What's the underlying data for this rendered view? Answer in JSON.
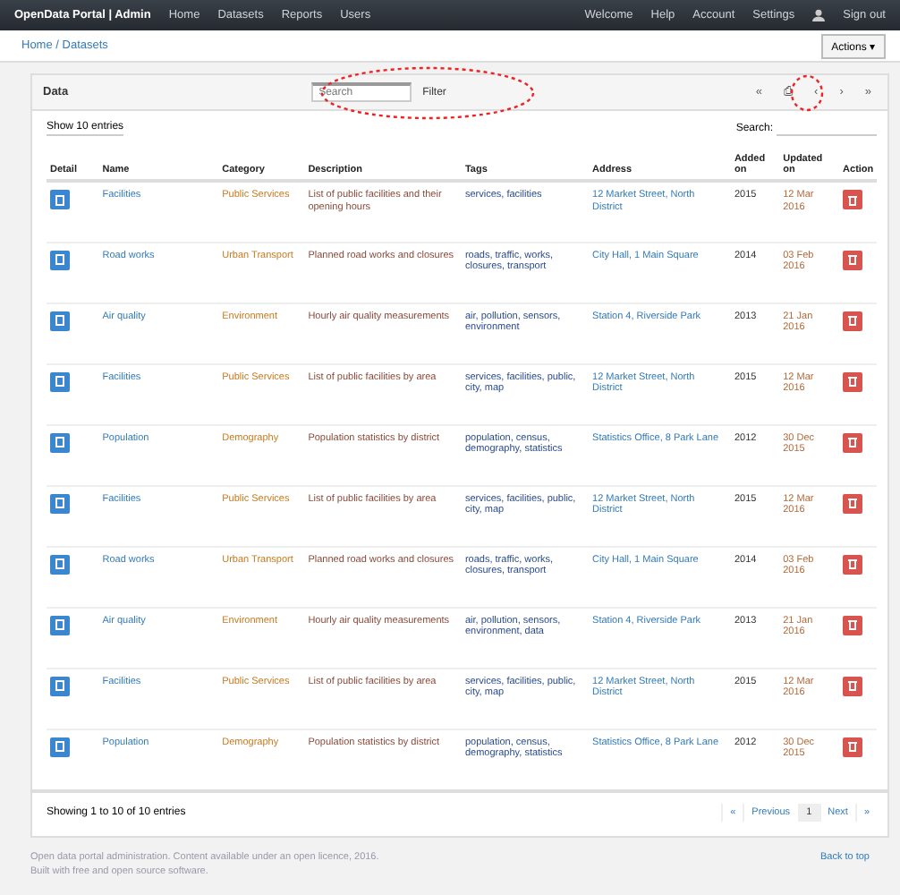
{
  "navbar": {
    "brand": "OpenData Portal | Admin",
    "links": [
      "Home",
      "Datasets",
      "Reports",
      "Users"
    ],
    "right_links": [
      "Welcome",
      "Help",
      "Account",
      "Settings"
    ],
    "user": "Sign out"
  },
  "subbar": {
    "breadcrumb": "Home / Datasets",
    "action": "Actions ▾"
  },
  "panel": {
    "title": "Data",
    "search": {
      "placeholder": "Search"
    },
    "filter": "Filter",
    "tools": [
      "«",
      "⎙",
      "‹",
      "›",
      "»"
    ]
  },
  "table": {
    "length": "Show 10 entries",
    "search_label": "Search:",
    "columns": [
      "Detail",
      "Name",
      "Category",
      "Description",
      "Tags",
      "Address",
      "Added on",
      "Updated on",
      "Action"
    ],
    "rows": [
      {
        "name": "Facilities",
        "category": "Public Services",
        "description": "List of public facilities and their opening hours",
        "tags": "services, facilities",
        "address": "12 Market Street, North District",
        "added": "2015",
        "updated": "12 Mar 2016"
      },
      {
        "name": "Road works",
        "category": "Urban Transport",
        "description": "Planned road works and closures",
        "tags": "roads, traffic, works, closures, transport",
        "address": "City Hall, 1 Main Square",
        "added": "2014",
        "updated": "03 Feb 2016"
      },
      {
        "name": "Air quality",
        "category": "Environment",
        "description": "Hourly air quality measurements",
        "tags": "air, pollution, sensors, environment",
        "address": "Station 4, Riverside Park",
        "added": "2013",
        "updated": "21 Jan 2016"
      },
      {
        "name": "Facilities",
        "category": "Public Services",
        "description": "List of public facilities by area",
        "tags": "services, facilities, public, city, map",
        "address": "12 Market Street, North District",
        "added": "2015",
        "updated": "12 Mar 2016"
      },
      {
        "name": "Population",
        "category": "Demography",
        "description": "Population statistics by district",
        "tags": "population, census, demography, statistics",
        "address": "Statistics Office, 8 Park Lane",
        "added": "2012",
        "updated": "30 Dec 2015"
      },
      {
        "name": "Facilities",
        "category": "Public Services",
        "description": "List of public facilities by area",
        "tags": "services, facilities, public, city, map",
        "address": "12 Market Street, North District",
        "added": "2015",
        "updated": "12 Mar 2016"
      },
      {
        "name": "Road works",
        "category": "Urban Transport",
        "description": "Planned road works and closures",
        "tags": "roads, traffic, works, closures, transport",
        "address": "City Hall, 1 Main Square",
        "added": "2014",
        "updated": "03 Feb 2016"
      },
      {
        "name": "Air quality",
        "category": "Environment",
        "description": "Hourly air quality measurements",
        "tags": "air, pollution, sensors, environment, data",
        "address": "Station 4, Riverside Park",
        "added": "2013",
        "updated": "21 Jan 2016"
      },
      {
        "name": "Facilities",
        "category": "Public Services",
        "description": "List of public facilities by area",
        "tags": "services, facilities, public, city, map",
        "address": "12 Market Street, North District",
        "added": "2015",
        "updated": "12 Mar 2016"
      },
      {
        "name": "Population",
        "category": "Demography",
        "description": "Population statistics by district",
        "tags": "population, census, demography, statistics",
        "address": "Statistics Office, 8 Park Lane",
        "added": "2012",
        "updated": "30 Dec 2015"
      }
    ],
    "info": "Showing 1 to 10 of 10 entries",
    "pages": [
      {
        "label": "«",
        "selected": false
      },
      {
        "label": "Previous",
        "selected": false
      },
      {
        "label": "1",
        "selected": true
      },
      {
        "label": "Next",
        "selected": false
      },
      {
        "label": "»",
        "selected": false
      }
    ]
  },
  "footer": {
    "text": "Open data portal administration. Content available under an open licence, 2016.",
    "text2": "Built with free and open source software.",
    "right": "Back to top"
  }
}
